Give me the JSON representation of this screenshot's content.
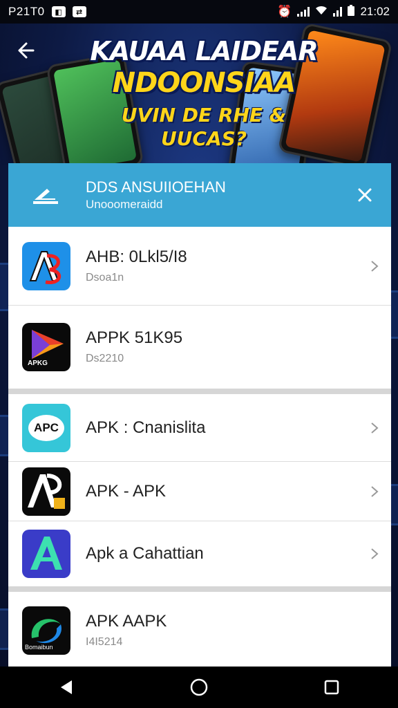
{
  "status_bar": {
    "left_time": "P21T0",
    "right_time": "21:02"
  },
  "hero": {
    "title": "KAUAA LAIDEAR",
    "subtitle": "NDOONSIAA",
    "tagline": "UVIN DE RHE & UUCAS?"
  },
  "dialog": {
    "title": "DDS ANSUIIOEHAN",
    "subtitle": "Unooomeraidd"
  },
  "apps": [
    {
      "title": "AHB: 0Lkl5/I8",
      "subtitle": "Dsoa1n",
      "icon": "ab-logo-icon",
      "chevron": true
    },
    {
      "title": "APPK 51K95",
      "subtitle": "Ds2210",
      "icon": "play-triangle-icon",
      "chevron": false
    },
    {
      "title": "APK : Cnanislita",
      "subtitle": "",
      "icon": "apc-logo-icon",
      "chevron": true
    },
    {
      "title": "APK - APK",
      "subtitle": "",
      "icon": "ap-logo-icon",
      "chevron": true
    },
    {
      "title": "Apk a Cahattian",
      "subtitle": "",
      "icon": "a-logo-icon",
      "chevron": true
    },
    {
      "title": "APK AAPK",
      "subtitle": "I4I5214",
      "icon": "swirl-logo-icon",
      "chevron": false
    }
  ],
  "icon_labels": {
    "apc": "APC",
    "apkg": "APKG",
    "swirl": "Bomaibun"
  },
  "colors": {
    "header": "#3aa6d4",
    "accent_yellow": "#ffd51a"
  }
}
